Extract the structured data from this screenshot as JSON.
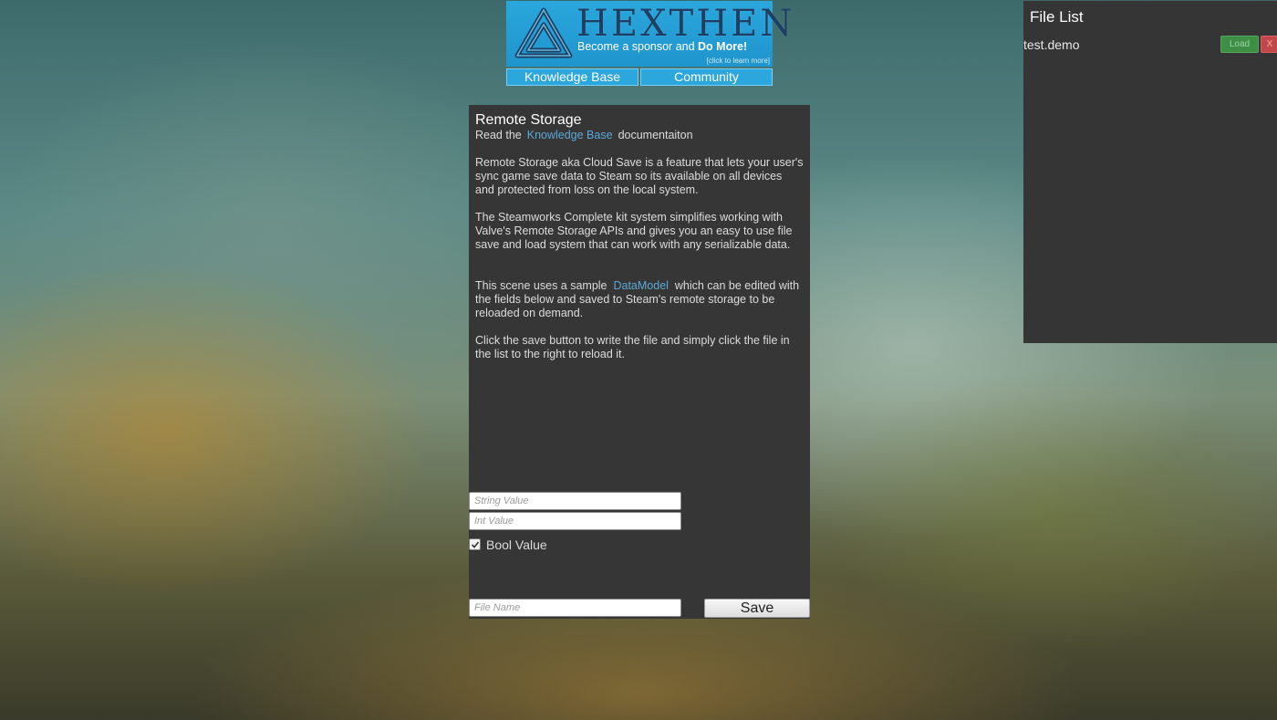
{
  "banner": {
    "name": "HEXTHEN",
    "tagline_prefix": "Become a sponsor and ",
    "tagline_bold": "Do More!",
    "small_text": "[click to learn more]"
  },
  "nav": {
    "knowledge_base": "Knowledge Base",
    "community": "Community"
  },
  "panel": {
    "title": "Remote Storage",
    "read_prefix": "Read the",
    "read_link": "Knowledge Base",
    "read_suffix": "documentaiton",
    "paragraph1": "Remote Storage aka Cloud Save is a feature that lets your user's sync game save data to Steam so its available on all devices and protected from loss on the local system.",
    "paragraph2": "The Steamworks Complete kit system simplifies working with Valve's Remote Storage APIs and gives you an easy to use file save and load system that can work with any serializable data.",
    "paragraph3_prefix": "This scene uses a sample",
    "paragraph3_link": "DataModel",
    "paragraph3_suffix": "which can be edited with the fields below and saved to Steam's remote storage to be reloaded on demand.",
    "paragraph4": "Click the save button to write the file and simply click the file in the list to the right to reload it.",
    "string_placeholder": "String Value",
    "int_placeholder": "Int Value",
    "bool_label": "Bool Value",
    "bool_checked": true,
    "file_placeholder": "File Name",
    "save_label": "Save"
  },
  "file_list": {
    "title": "File List",
    "files": [
      {
        "name": "test.demo",
        "load_label": "Load",
        "delete_label": "X"
      }
    ]
  },
  "icons": {
    "banner_logo": "valknut-triangle-icon",
    "checkbox": "checkmark-icon"
  }
}
